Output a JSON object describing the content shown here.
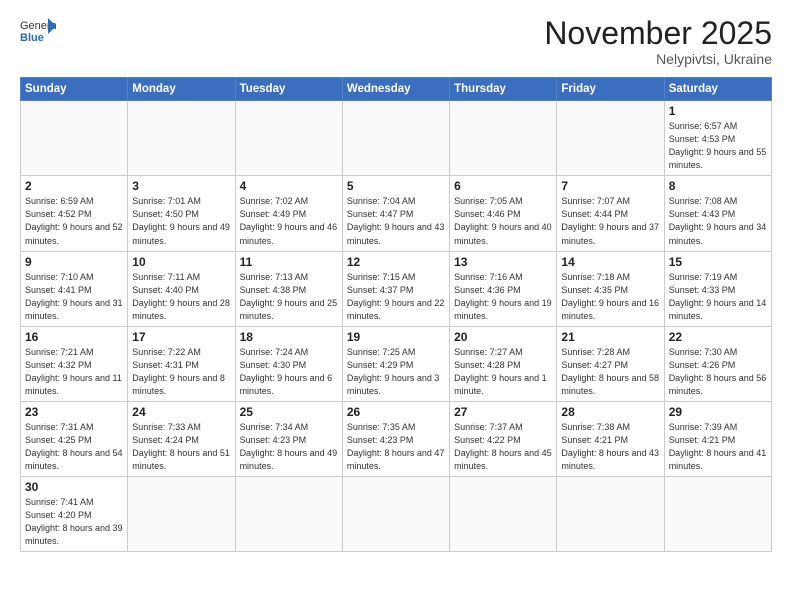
{
  "header": {
    "logo_general": "General",
    "logo_blue": "Blue",
    "month_title": "November 2025",
    "subtitle": "Nelypivtsi, Ukraine"
  },
  "weekdays": [
    "Sunday",
    "Monday",
    "Tuesday",
    "Wednesday",
    "Thursday",
    "Friday",
    "Saturday"
  ],
  "weeks": [
    [
      {
        "day": "",
        "info": ""
      },
      {
        "day": "",
        "info": ""
      },
      {
        "day": "",
        "info": ""
      },
      {
        "day": "",
        "info": ""
      },
      {
        "day": "",
        "info": ""
      },
      {
        "day": "",
        "info": ""
      },
      {
        "day": "1",
        "info": "Sunrise: 6:57 AM\nSunset: 4:53 PM\nDaylight: 9 hours and 55 minutes."
      }
    ],
    [
      {
        "day": "2",
        "info": "Sunrise: 6:59 AM\nSunset: 4:52 PM\nDaylight: 9 hours and 52 minutes."
      },
      {
        "day": "3",
        "info": "Sunrise: 7:01 AM\nSunset: 4:50 PM\nDaylight: 9 hours and 49 minutes."
      },
      {
        "day": "4",
        "info": "Sunrise: 7:02 AM\nSunset: 4:49 PM\nDaylight: 9 hours and 46 minutes."
      },
      {
        "day": "5",
        "info": "Sunrise: 7:04 AM\nSunset: 4:47 PM\nDaylight: 9 hours and 43 minutes."
      },
      {
        "day": "6",
        "info": "Sunrise: 7:05 AM\nSunset: 4:46 PM\nDaylight: 9 hours and 40 minutes."
      },
      {
        "day": "7",
        "info": "Sunrise: 7:07 AM\nSunset: 4:44 PM\nDaylight: 9 hours and 37 minutes."
      },
      {
        "day": "8",
        "info": "Sunrise: 7:08 AM\nSunset: 4:43 PM\nDaylight: 9 hours and 34 minutes."
      }
    ],
    [
      {
        "day": "9",
        "info": "Sunrise: 7:10 AM\nSunset: 4:41 PM\nDaylight: 9 hours and 31 minutes."
      },
      {
        "day": "10",
        "info": "Sunrise: 7:11 AM\nSunset: 4:40 PM\nDaylight: 9 hours and 28 minutes."
      },
      {
        "day": "11",
        "info": "Sunrise: 7:13 AM\nSunset: 4:38 PM\nDaylight: 9 hours and 25 minutes."
      },
      {
        "day": "12",
        "info": "Sunrise: 7:15 AM\nSunset: 4:37 PM\nDaylight: 9 hours and 22 minutes."
      },
      {
        "day": "13",
        "info": "Sunrise: 7:16 AM\nSunset: 4:36 PM\nDaylight: 9 hours and 19 minutes."
      },
      {
        "day": "14",
        "info": "Sunrise: 7:18 AM\nSunset: 4:35 PM\nDaylight: 9 hours and 16 minutes."
      },
      {
        "day": "15",
        "info": "Sunrise: 7:19 AM\nSunset: 4:33 PM\nDaylight: 9 hours and 14 minutes."
      }
    ],
    [
      {
        "day": "16",
        "info": "Sunrise: 7:21 AM\nSunset: 4:32 PM\nDaylight: 9 hours and 11 minutes."
      },
      {
        "day": "17",
        "info": "Sunrise: 7:22 AM\nSunset: 4:31 PM\nDaylight: 9 hours and 8 minutes."
      },
      {
        "day": "18",
        "info": "Sunrise: 7:24 AM\nSunset: 4:30 PM\nDaylight: 9 hours and 6 minutes."
      },
      {
        "day": "19",
        "info": "Sunrise: 7:25 AM\nSunset: 4:29 PM\nDaylight: 9 hours and 3 minutes."
      },
      {
        "day": "20",
        "info": "Sunrise: 7:27 AM\nSunset: 4:28 PM\nDaylight: 9 hours and 1 minute."
      },
      {
        "day": "21",
        "info": "Sunrise: 7:28 AM\nSunset: 4:27 PM\nDaylight: 8 hours and 58 minutes."
      },
      {
        "day": "22",
        "info": "Sunrise: 7:30 AM\nSunset: 4:26 PM\nDaylight: 8 hours and 56 minutes."
      }
    ],
    [
      {
        "day": "23",
        "info": "Sunrise: 7:31 AM\nSunset: 4:25 PM\nDaylight: 8 hours and 54 minutes."
      },
      {
        "day": "24",
        "info": "Sunrise: 7:33 AM\nSunset: 4:24 PM\nDaylight: 8 hours and 51 minutes."
      },
      {
        "day": "25",
        "info": "Sunrise: 7:34 AM\nSunset: 4:23 PM\nDaylight: 8 hours and 49 minutes."
      },
      {
        "day": "26",
        "info": "Sunrise: 7:35 AM\nSunset: 4:23 PM\nDaylight: 8 hours and 47 minutes."
      },
      {
        "day": "27",
        "info": "Sunrise: 7:37 AM\nSunset: 4:22 PM\nDaylight: 8 hours and 45 minutes."
      },
      {
        "day": "28",
        "info": "Sunrise: 7:38 AM\nSunset: 4:21 PM\nDaylight: 8 hours and 43 minutes."
      },
      {
        "day": "29",
        "info": "Sunrise: 7:39 AM\nSunset: 4:21 PM\nDaylight: 8 hours and 41 minutes."
      }
    ],
    [
      {
        "day": "30",
        "info": "Sunrise: 7:41 AM\nSunset: 4:20 PM\nDaylight: 8 hours and 39 minutes."
      },
      {
        "day": "",
        "info": ""
      },
      {
        "day": "",
        "info": ""
      },
      {
        "day": "",
        "info": ""
      },
      {
        "day": "",
        "info": ""
      },
      {
        "day": "",
        "info": ""
      },
      {
        "day": "",
        "info": ""
      }
    ]
  ]
}
